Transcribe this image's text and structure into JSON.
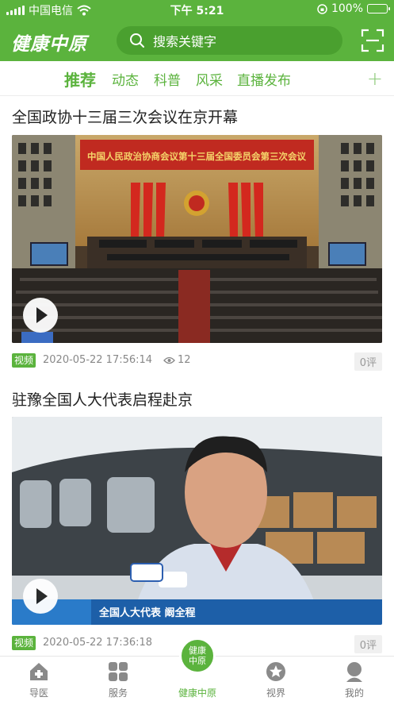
{
  "status_bar": {
    "carrier": "中国电信",
    "time": "下午 5:21",
    "battery": "100%"
  },
  "header": {
    "logo": "健康中原",
    "search_placeholder": "搜索关键字"
  },
  "tabs": [
    "推荐",
    "动态",
    "科普",
    "风采",
    "直播发布"
  ],
  "articles": [
    {
      "title": "全国政协十三届三次会议在京开幕",
      "thumb_banner": "中国人民政治协商会议第十三届全国委员会第三次会议",
      "badge": "视频",
      "date": "2020-05-22 17:56:14",
      "views": "12",
      "comments": "0评"
    },
    {
      "title": "驻豫全国人大代表启程赴京",
      "thumb_caption": "全国人大代表  阚全程",
      "badge": "视频",
      "date": "2020-05-22 17:36:18",
      "comments": "0评"
    }
  ],
  "tabbar": {
    "items": [
      "导医",
      "服务",
      "健康中原",
      "视界",
      "我的"
    ],
    "center_text": "健康\n中原"
  },
  "colors": {
    "brand_green": "#5bb33d"
  }
}
